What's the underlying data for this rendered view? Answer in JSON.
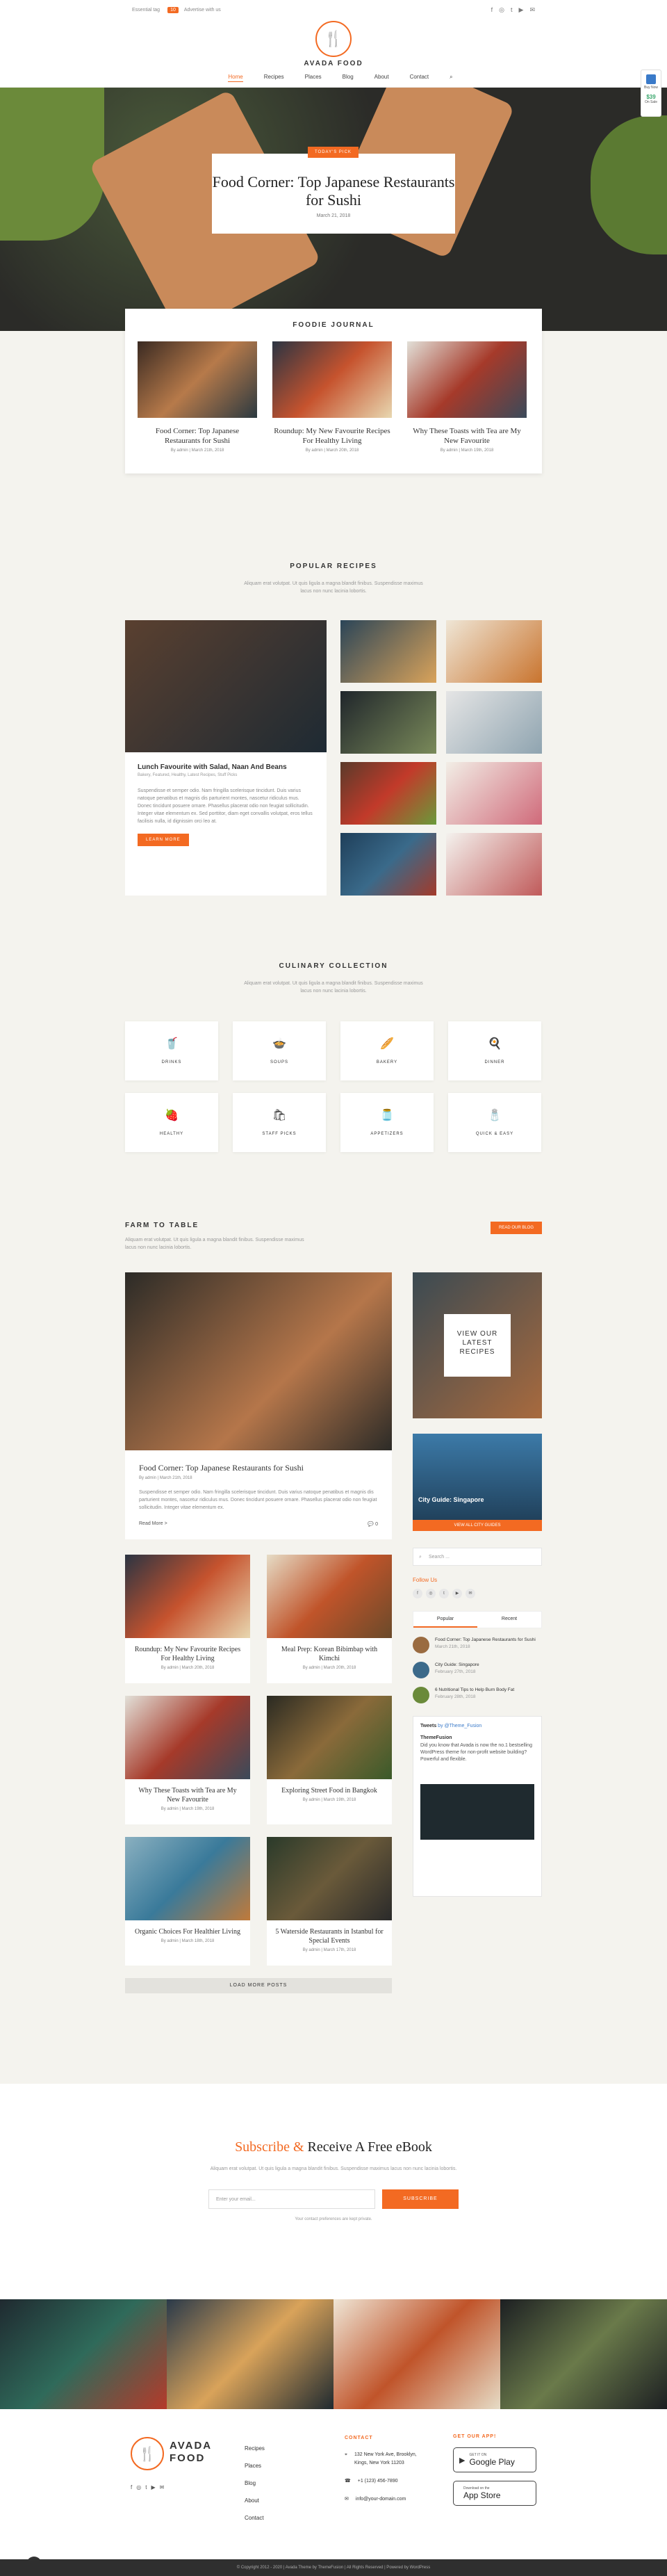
{
  "topbar": {
    "left_a": "Essential tag",
    "badge": "10",
    "left_b": "Advertise with us",
    "social": [
      "f",
      "◎",
      "t",
      "▶",
      "✉"
    ]
  },
  "header": {
    "logo_text": "AVADA FOOD",
    "nav": [
      "Home",
      "Recipes",
      "Places",
      "Blog",
      "About",
      "Contact"
    ]
  },
  "widget": {
    "label": "Buy Now",
    "price": "$39",
    "sub": "On Sale"
  },
  "hero": {
    "pill": "TODAY'S PICK",
    "title": "Food Corner: Top Japanese Restaurants for Sushi",
    "date": "March 21, 2018"
  },
  "journal": {
    "title": "FOODIE JOURNAL",
    "cards": [
      {
        "title": "Food Corner: Top Japanese Restaurants for Sushi",
        "meta": "By admin | March 21th, 2018"
      },
      {
        "title": "Roundup: My New Favourite Recipes For Healthy Living",
        "meta": "By admin | March 20th, 2018"
      },
      {
        "title": "Why These Toasts with Tea are My New Favourite",
        "meta": "By admin | March 19th, 2018"
      }
    ]
  },
  "popular": {
    "title": "POPULAR RECIPES",
    "sub": "Aliquam erat volutpat. Ut quis ligula a magna blandit finibus. Suspendisse maximus lacus non nunc lacinia lobortis.",
    "main_title": "Lunch Favourite with Salad, Naan And Beans",
    "main_cats": "Bakery, Featured, Healthy, Latest Recipes, Stuff Picks",
    "main_text": "Suspendisse et semper odio. Nam fringilla scelerisque tincidunt. Duis varius natoque penatibus et magnis dis parturient montes, nascetur ridiculus mus. Donec tincidunt posuere ornare. Phasellus placerat odio non feugiat sollicitudin. Integer vitae elementum ex. Sed porttitor, diam eget convallis volutpat, eros tellus facilisis nulla, id dignissim orci leo at.",
    "button": "LEARN MORE"
  },
  "culinary": {
    "title": "CULINARY COLLECTION",
    "sub": "Aliquam erat volutpat. Ut quis ligula a magna blandit finibus. Suspendisse maximus lacus non nunc lacinia lobortis.",
    "items": [
      {
        "icon": "drink-icon",
        "glyph": "🥤",
        "label": "DRINKS"
      },
      {
        "icon": "soup-icon",
        "glyph": "🍲",
        "label": "SOUPS"
      },
      {
        "icon": "bread-icon",
        "glyph": "🥖",
        "label": "BAKERY"
      },
      {
        "icon": "pan-icon",
        "glyph": "🍳",
        "label": "DINNER"
      },
      {
        "icon": "strawberry-icon",
        "glyph": "🍓",
        "label": "HEALTHY"
      },
      {
        "icon": "bag-icon",
        "glyph": "🛍",
        "label": "STAFF PICKS"
      },
      {
        "icon": "jar-icon",
        "glyph": "🫙",
        "label": "APPETIZERS"
      },
      {
        "icon": "spice-icon",
        "glyph": "🧂",
        "label": "QUICK & EASY"
      }
    ]
  },
  "farm": {
    "title": "FARM TO TABLE",
    "sub": "Aliquam erat volutpat. Ut quis ligula a magna blandit finibus. Suspendisse maximus lacus non nunc lacinia lobortis.",
    "button": "READ OUR BLOG",
    "feature": {
      "title": "Food Corner: Top Japanese Restaurants for Sushi",
      "meta": "By admin | March 21th, 2018",
      "text": "Suspendisse et semper odio. Nam fringilla scelerisque tincidunt. Duis varius natoque penatibus et magnis dis parturient montes, nascetur ridiculus mus. Donec tincidunt posuere ornare. Phasellus placerat odio non feugiat sollicitudin. Integer vitae elementum ex.",
      "read_more": "Read More >",
      "comments": "0"
    },
    "posts": [
      {
        "title": "Roundup: My New Favourite Recipes For Healthy Living",
        "meta": "By admin | March 20th, 2018"
      },
      {
        "title": "Meal Prep: Korean Bibimbap with Kimchi",
        "meta": "By admin | March 20th, 2018"
      },
      {
        "title": "Why These Toasts with Tea are My New Favourite",
        "meta": "By admin | March 19th, 2018"
      },
      {
        "title": "Exploring Street Food in Bangkok",
        "meta": "By admin | March 19th, 2018"
      },
      {
        "title": "Organic Choices For Healthier Living",
        "meta": "By admin | March 18th, 2018"
      },
      {
        "title": "5 Waterside Restaurants in Istanbul for Special Events",
        "meta": "By admin | March 17th, 2018"
      }
    ],
    "load_more": "LOAD MORE POSTS"
  },
  "sidebar": {
    "promo": "VIEW OUR LATEST RECIPES",
    "city_title": "City Guide: Singapore",
    "city_button": "VIEW ALL CITY GUIDES",
    "search_placeholder": "Search ...",
    "follow": "Follow Us",
    "tabs": [
      "Popular",
      "Recent"
    ],
    "popular": [
      {
        "title": "Food Corner: Top Japanese Restaurants for Sushi",
        "date": "March 21th, 2018"
      },
      {
        "title": "City Guide: Singapore",
        "date": "February 27th, 2018"
      },
      {
        "title": "6 Nutritional Tips to Help Burn Body Fat",
        "date": "February 28th, 2018"
      }
    ],
    "tweets_title": "Tweets",
    "tweets_by": "by @Theme_Fusion",
    "tweet_author": "ThemeFusion",
    "tweet_text": "Did you know that Avada is now the no.1 bestselling WordPress theme for non-profit website building? Powerful and flexible."
  },
  "subscribe": {
    "title_a": "Subscribe",
    "title_amp": "&",
    "title_b": "Receive A Free eBook",
    "sub": "Aliquam erat volutpat. Ut quis ligula a magna blandit finibus. Suspendisse maximus lacus non nunc lacinia lobortis.",
    "placeholder": "Enter your email...",
    "button": "SUBSCRIBE",
    "note": "Your contact preferences are kept private."
  },
  "footer": {
    "logo_a": "AVADA",
    "logo_b": "FOOD",
    "links": [
      "Recipes",
      "Places",
      "Blog",
      "About",
      "Contact"
    ],
    "contact_title": "CONTACT",
    "address": "132 New York Ave, Brooklyn, Kings, New York 11203",
    "phone": "+1 (123) 456-7890",
    "email": "info@your-domain.com",
    "app_title": "GET OUR APP!",
    "google_sm": "GET IT ON",
    "google_lg": "Google Play",
    "apple_sm": "Download on the",
    "apple_lg": "App Store",
    "copyright": "© Copyright 2012 - 2020 | Avada Theme by ThemeFusion | All Rights Reserved | Powered by WordPress"
  }
}
